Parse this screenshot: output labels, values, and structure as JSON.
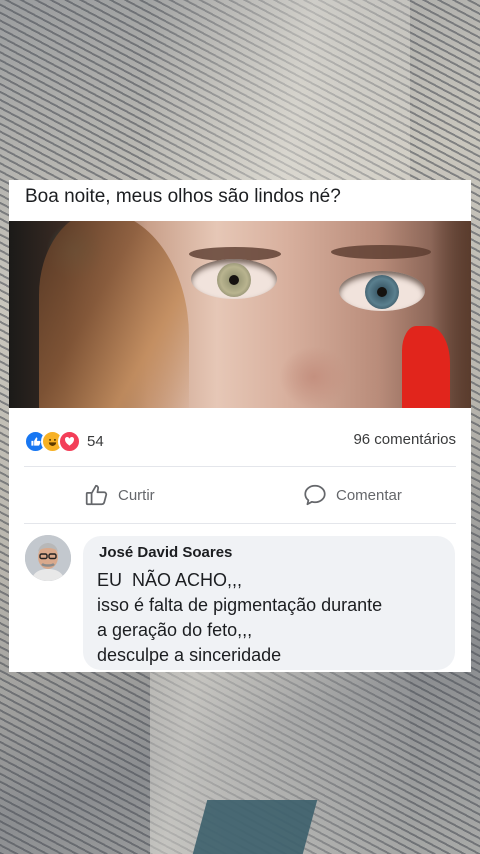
{
  "post": {
    "text": "Boa noite, meus olhos são lindos né?"
  },
  "reactions": {
    "count": "54",
    "comments": "96 comentários",
    "icons": [
      "like-icon",
      "haha-icon",
      "love-icon"
    ]
  },
  "actions": {
    "like_label": "Curtir",
    "comment_label": "Comentar"
  },
  "comment": {
    "author": "José David Soares",
    "lines": [
      "EU  NÃO ACHO,,,",
      "isso é falta de pigmentação durante",
      "a geração do feto,,,",
      "desculpe a sinceridade"
    ]
  },
  "colors": {
    "like_blue": "#1877f2",
    "haha_yellow": "#f7b125",
    "love_red": "#f33e58",
    "bubble_bg": "#f0f2f5",
    "redaction": "#e1251c"
  }
}
